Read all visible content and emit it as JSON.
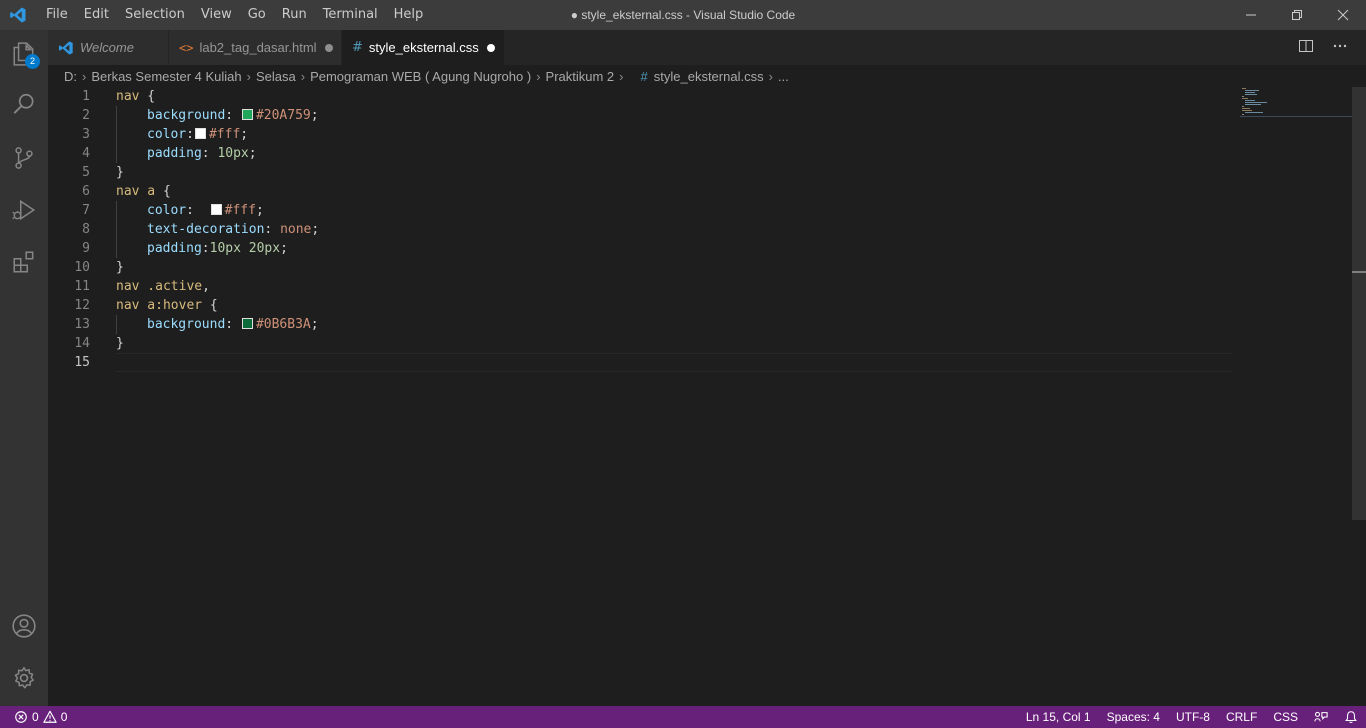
{
  "titlebar": {
    "menu": [
      "File",
      "Edit",
      "Selection",
      "View",
      "Go",
      "Run",
      "Terminal",
      "Help"
    ],
    "window_title": "● style_eksternal.css - Visual Studio Code"
  },
  "activity_bar": {
    "explorer_badge": "2",
    "icons": [
      "explorer-icon",
      "search-icon",
      "source-control-icon",
      "run-debug-icon",
      "extensions-icon",
      "account-icon",
      "settings-gear-icon"
    ]
  },
  "tabs": [
    {
      "label": "Welcome",
      "icon": "vscode-icon",
      "dirty": false,
      "active": false
    },
    {
      "label": "lab2_tag_dasar.html",
      "icon": "html-icon",
      "dirty": true,
      "active": false
    },
    {
      "label": "style_eksternal.css",
      "icon": "css-icon",
      "dirty": true,
      "active": true
    }
  ],
  "tab_icon_glyphs": {
    "html": "<>",
    "css": "#"
  },
  "breadcrumbs": {
    "items": [
      "D:",
      "Berkas Semester 4 Kuliah",
      "Selasa",
      "Pemograman WEB ( Agung Nugroho )",
      "Praktikum 2"
    ],
    "file": "style_eksternal.css",
    "more": "..."
  },
  "editor": {
    "line_numbers": [
      "1",
      "2",
      "3",
      "4",
      "5",
      "6",
      "7",
      "8",
      "9",
      "10",
      "11",
      "12",
      "13",
      "14",
      "15"
    ],
    "current_line": 15,
    "code": {
      "l1_sel": "nav",
      "l1_brace": " {",
      "l2_prop": "background",
      "l2_val": "#20A759",
      "l3_prop": "color",
      "l3_val": "#fff",
      "l4_prop": "padding",
      "l4_val": "10px",
      "l5": "}",
      "l6_sel": "nav a",
      "l6_brace": " {",
      "l7_prop": "color",
      "l7_val": "#fff",
      "l8_prop": "text-decoration",
      "l8_val": "none",
      "l9_prop": "padding",
      "l9_val": "10px 20px",
      "l10": "}",
      "l11_sel": "nav .active",
      "l12_sel": "nav a:hover",
      "l12_brace": " {",
      "l13_prop": "background",
      "l13_val": "#0B6B3A",
      "l14": "}"
    },
    "swatches": [
      "#20A759",
      "#ffffff",
      "#ffffff",
      "#0B6B3A"
    ]
  },
  "statusbar": {
    "errors": "0",
    "warnings": "0",
    "position": "Ln 15, Col 1",
    "spaces": "Spaces: 4",
    "encoding": "UTF-8",
    "eol": "CRLF",
    "language": "CSS"
  },
  "colors": {
    "statusbar": "#68217a",
    "accent": "#007acc",
    "titlebar": "#3c3c3c",
    "editor_bg": "#1e1e1e"
  }
}
